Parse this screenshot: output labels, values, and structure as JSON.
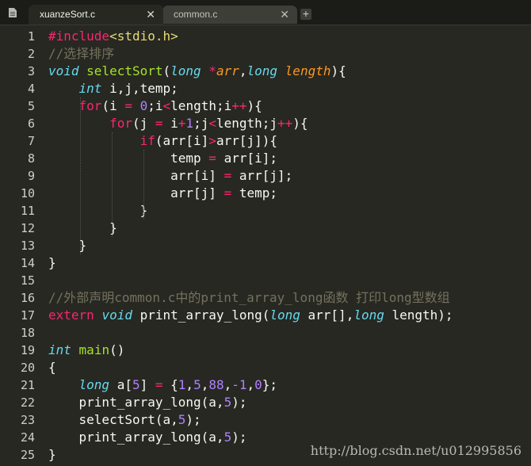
{
  "tabs": [
    {
      "label": "xuanzeSort.c",
      "close": "✕",
      "active": true
    },
    {
      "label": "common.c",
      "close": "✕",
      "active": false
    }
  ],
  "new_tab_label": "+",
  "sidebar_icon": "file-icon",
  "line_numbers": [
    "1",
    "2",
    "3",
    "4",
    "5",
    "6",
    "7",
    "8",
    "9",
    "10",
    "11",
    "12",
    "13",
    "14",
    "15",
    "16",
    "17",
    "18",
    "19",
    "20",
    "21",
    "22",
    "23",
    "24",
    "25"
  ],
  "code_lines": [
    [
      {
        "t": "#include",
        "c": "kw"
      },
      {
        "t": "<stdio.h>",
        "c": "st"
      }
    ],
    [
      {
        "t": "//选择排序",
        "c": "cm"
      }
    ],
    [
      {
        "t": "void",
        "c": "ty"
      },
      {
        "t": " ",
        "c": "tx"
      },
      {
        "t": "selectSort",
        "c": "fn"
      },
      {
        "t": "(",
        "c": "tx"
      },
      {
        "t": "long",
        "c": "ty"
      },
      {
        "t": " ",
        "c": "tx"
      },
      {
        "t": "*",
        "c": "kw"
      },
      {
        "t": "arr",
        "c": "pr"
      },
      {
        "t": ",",
        "c": "tx"
      },
      {
        "t": "long",
        "c": "ty"
      },
      {
        "t": " ",
        "c": "tx"
      },
      {
        "t": "length",
        "c": "pr"
      },
      {
        "t": "){",
        "c": "tx"
      }
    ],
    [
      {
        "t": "    ",
        "c": "tx"
      },
      {
        "t": "int",
        "c": "ty"
      },
      {
        "t": " i,j,temp;",
        "c": "tx"
      }
    ],
    [
      {
        "t": "    ",
        "c": "tx"
      },
      {
        "t": "for",
        "c": "kw"
      },
      {
        "t": "(i ",
        "c": "tx"
      },
      {
        "t": "=",
        "c": "kw"
      },
      {
        "t": " ",
        "c": "tx"
      },
      {
        "t": "0",
        "c": "nm"
      },
      {
        "t": ";i",
        "c": "tx"
      },
      {
        "t": "<",
        "c": "kw"
      },
      {
        "t": "length;i",
        "c": "tx"
      },
      {
        "t": "++",
        "c": "kw"
      },
      {
        "t": "){",
        "c": "tx"
      }
    ],
    [
      {
        "t": "        ",
        "c": "tx"
      },
      {
        "t": "for",
        "c": "kw"
      },
      {
        "t": "(j ",
        "c": "tx"
      },
      {
        "t": "=",
        "c": "kw"
      },
      {
        "t": " i",
        "c": "tx"
      },
      {
        "t": "+",
        "c": "kw"
      },
      {
        "t": "1",
        "c": "nm"
      },
      {
        "t": ";j",
        "c": "tx"
      },
      {
        "t": "<",
        "c": "kw"
      },
      {
        "t": "length;j",
        "c": "tx"
      },
      {
        "t": "++",
        "c": "kw"
      },
      {
        "t": "){",
        "c": "tx"
      }
    ],
    [
      {
        "t": "            ",
        "c": "tx"
      },
      {
        "t": "if",
        "c": "kw"
      },
      {
        "t": "(arr[i]",
        "c": "tx"
      },
      {
        "t": ">",
        "c": "kw"
      },
      {
        "t": "arr[j]){",
        "c": "tx"
      }
    ],
    [
      {
        "t": "                temp ",
        "c": "tx"
      },
      {
        "t": "=",
        "c": "kw"
      },
      {
        "t": " arr[i];",
        "c": "tx"
      }
    ],
    [
      {
        "t": "                arr[i] ",
        "c": "tx"
      },
      {
        "t": "=",
        "c": "kw"
      },
      {
        "t": " arr[j];",
        "c": "tx"
      }
    ],
    [
      {
        "t": "                arr[j] ",
        "c": "tx"
      },
      {
        "t": "=",
        "c": "kw"
      },
      {
        "t": " temp;",
        "c": "tx"
      }
    ],
    [
      {
        "t": "            }",
        "c": "tx"
      }
    ],
    [
      {
        "t": "        }",
        "c": "tx"
      }
    ],
    [
      {
        "t": "    }",
        "c": "tx"
      }
    ],
    [
      {
        "t": "}",
        "c": "tx"
      }
    ],
    [],
    [
      {
        "t": "//外部声明common.c中的print_array_long函数 打印long型数组",
        "c": "cm"
      }
    ],
    [
      {
        "t": "extern",
        "c": "kw"
      },
      {
        "t": " ",
        "c": "tx"
      },
      {
        "t": "void",
        "c": "ty"
      },
      {
        "t": " print_array_long(",
        "c": "tx"
      },
      {
        "t": "long",
        "c": "ty"
      },
      {
        "t": " arr[],",
        "c": "tx"
      },
      {
        "t": "long",
        "c": "ty"
      },
      {
        "t": " length);",
        "c": "tx"
      }
    ],
    [],
    [
      {
        "t": "int",
        "c": "ty"
      },
      {
        "t": " ",
        "c": "tx"
      },
      {
        "t": "main",
        "c": "fn"
      },
      {
        "t": "()",
        "c": "tx"
      }
    ],
    [
      {
        "t": "{",
        "c": "tx"
      }
    ],
    [
      {
        "t": "    ",
        "c": "tx"
      },
      {
        "t": "long",
        "c": "ty"
      },
      {
        "t": " a[",
        "c": "tx"
      },
      {
        "t": "5",
        "c": "nm"
      },
      {
        "t": "] ",
        "c": "tx"
      },
      {
        "t": "=",
        "c": "kw"
      },
      {
        "t": " {",
        "c": "tx"
      },
      {
        "t": "1",
        "c": "nm"
      },
      {
        "t": ",",
        "c": "tx"
      },
      {
        "t": "5",
        "c": "nm"
      },
      {
        "t": ",",
        "c": "tx"
      },
      {
        "t": "88",
        "c": "nm"
      },
      {
        "t": ",",
        "c": "tx"
      },
      {
        "t": "-1",
        "c": "nm"
      },
      {
        "t": ",",
        "c": "tx"
      },
      {
        "t": "0",
        "c": "nm"
      },
      {
        "t": "};",
        "c": "tx"
      }
    ],
    [
      {
        "t": "    print_array_long(a,",
        "c": "tx"
      },
      {
        "t": "5",
        "c": "nm"
      },
      {
        "t": ");",
        "c": "tx"
      }
    ],
    [
      {
        "t": "    selectSort(a,",
        "c": "tx"
      },
      {
        "t": "5",
        "c": "nm"
      },
      {
        "t": ");",
        "c": "tx"
      }
    ],
    [
      {
        "t": "    print_array_long(a,",
        "c": "tx"
      },
      {
        "t": "5",
        "c": "nm"
      },
      {
        "t": ");",
        "c": "tx"
      }
    ],
    [
      {
        "t": "}",
        "c": "tx"
      }
    ]
  ],
  "watermark": "http://blog.csdn.net/u012995856",
  "colors": {
    "background": "#272822",
    "keyword": "#f92672",
    "type": "#66d9ef",
    "function": "#a6e22e",
    "number": "#ae81ff",
    "comment": "#75715e",
    "parameter": "#fd971f",
    "string": "#e6db74"
  }
}
